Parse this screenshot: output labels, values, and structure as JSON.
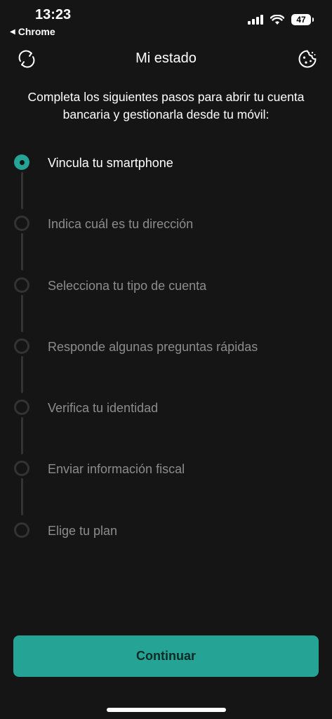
{
  "status_bar": {
    "time": "13:23",
    "back_label": "Chrome",
    "battery": "47"
  },
  "header": {
    "title": "Mi estado",
    "left_icon": "refresh-icon",
    "right_icon": "cookie-icon"
  },
  "intro_text": "Completa los siguientes pasos para abrir tu cuenta bancaria y gestionarla desde tu móvil:",
  "steps": [
    {
      "label": "Vincula tu smartphone",
      "state": "active"
    },
    {
      "label": "Indica cuál es tu dirección",
      "state": "pending"
    },
    {
      "label": "Selecciona tu tipo de cuenta",
      "state": "pending"
    },
    {
      "label": "Responde algunas preguntas rápidas",
      "state": "pending"
    },
    {
      "label": "Verifica tu identidad",
      "state": "pending"
    },
    {
      "label": "Enviar información fiscal",
      "state": "pending"
    },
    {
      "label": "Elige tu plan",
      "state": "pending"
    }
  ],
  "continue_button": {
    "label": "Continuar"
  },
  "colors": {
    "accent": "#25a394",
    "background": "#151515",
    "inactive_text": "#8c8c8c"
  }
}
